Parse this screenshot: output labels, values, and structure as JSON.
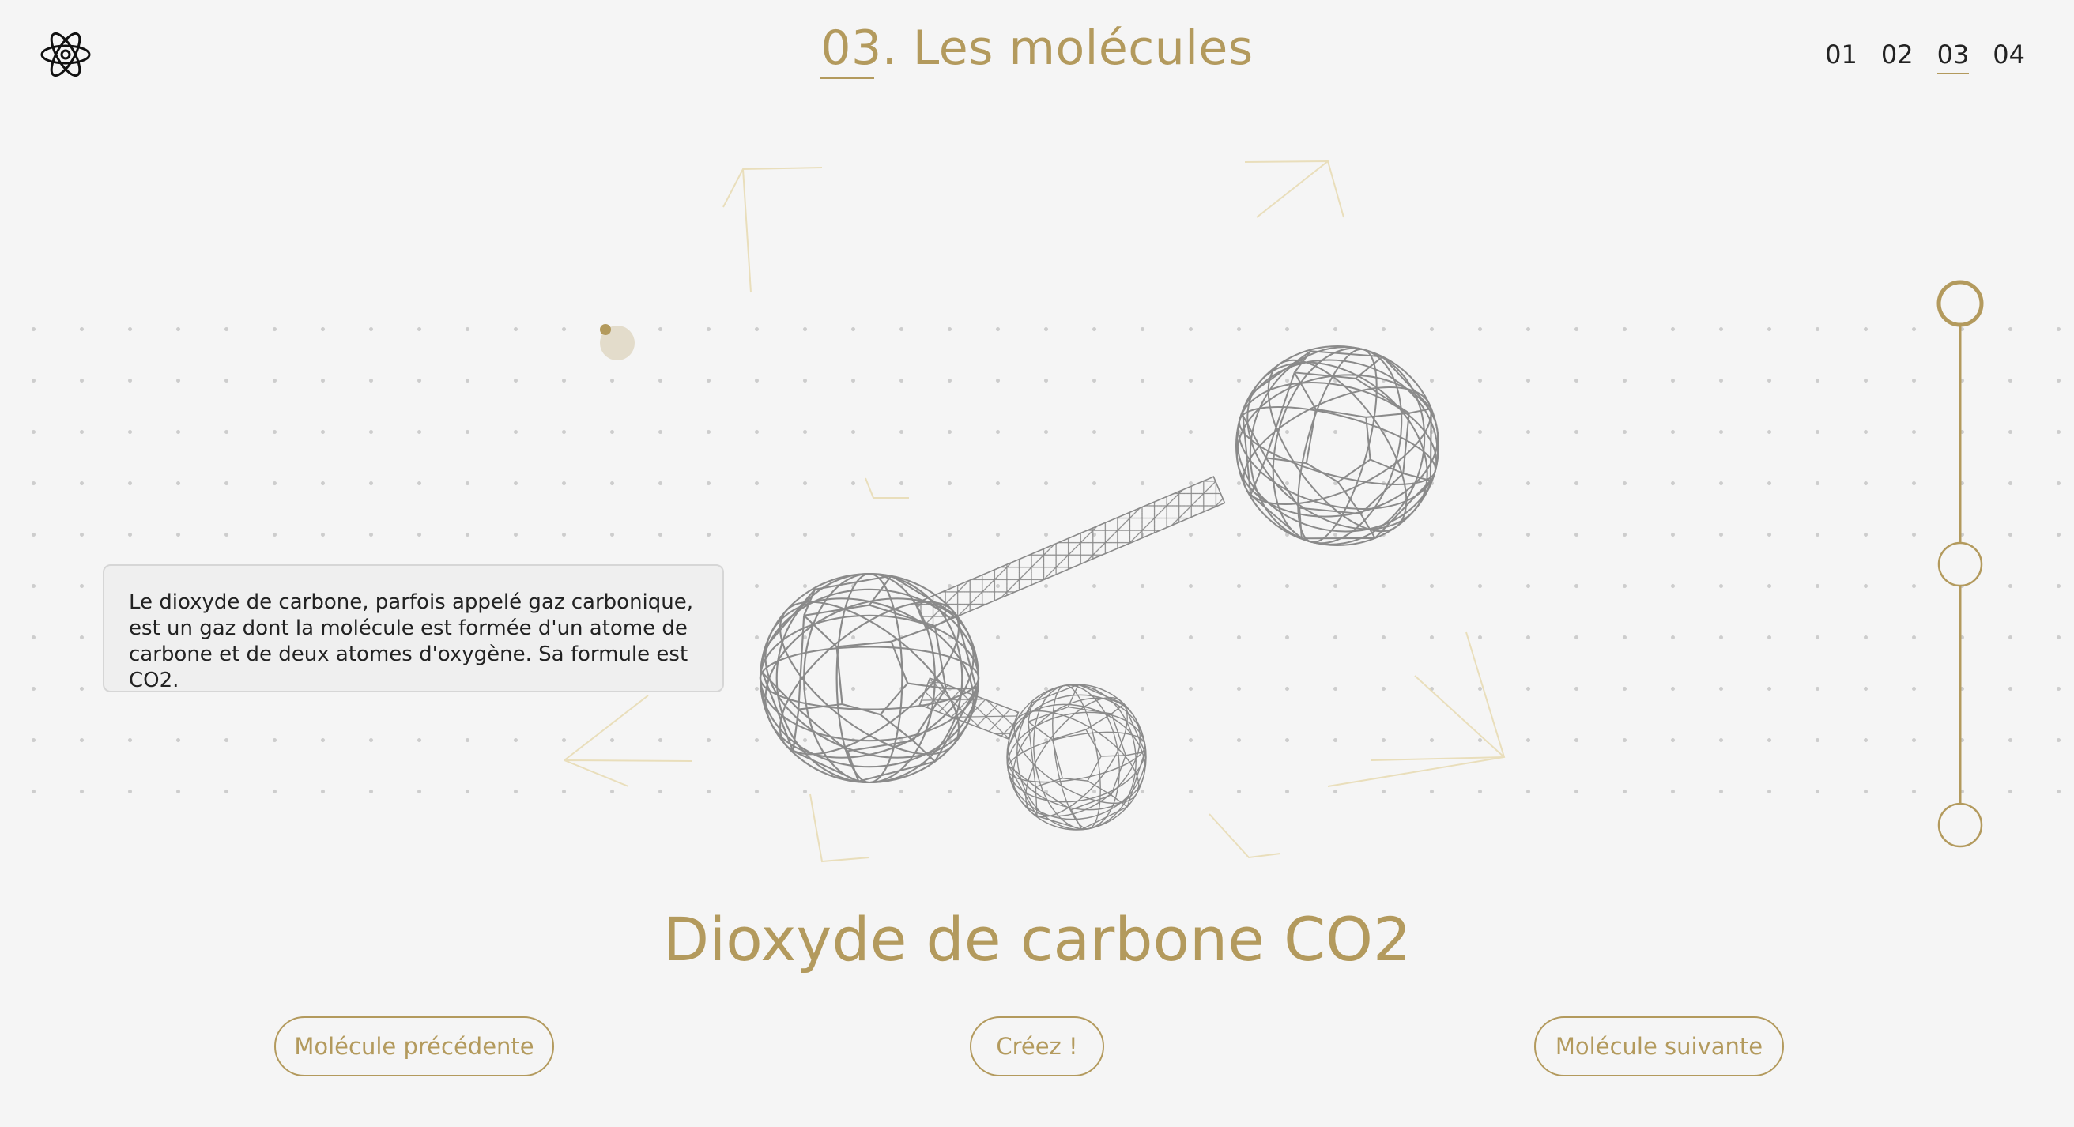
{
  "header": {
    "section_number": "03",
    "section_title": ". Les molécules",
    "nav": [
      {
        "label": "01",
        "active": false
      },
      {
        "label": "02",
        "active": false
      },
      {
        "label": "03",
        "active": true
      },
      {
        "label": "04",
        "active": false
      }
    ],
    "logo_icon": "atom-icon"
  },
  "main": {
    "description": "Le dioxyde de carbone, parfois appelé gaz carbonique, est un gaz dont la molécule est formée d'un atome de carbone et de deux atomes d'oxygène. Sa formule est CO2.",
    "molecule_name": "Dioxyde de carbone CO2",
    "slider_steps": 3,
    "slider_active_step": 1
  },
  "actions": {
    "prev_label": "Molécule précédente",
    "create_label": "Créez !",
    "next_label": "Molécule suivante"
  },
  "colors": {
    "accent": "#b39a5d",
    "background": "#f5f5f5",
    "text": "#222222",
    "wireframe": "#8a8a8a"
  }
}
